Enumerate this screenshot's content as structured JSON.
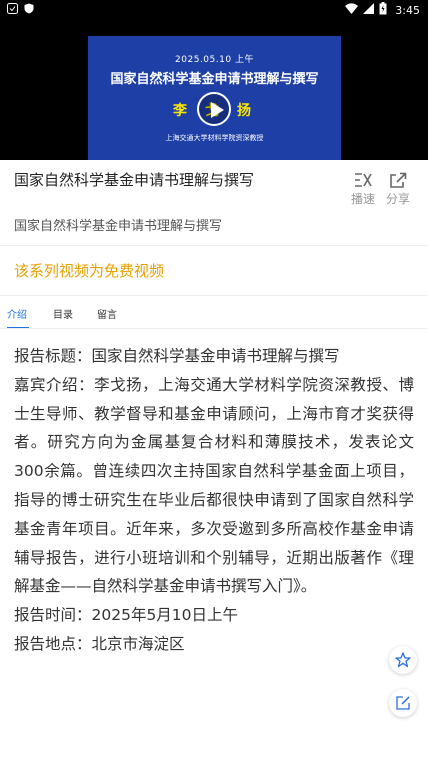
{
  "status_bar": {
    "time": "3:45",
    "battery": "battery-charging-icon",
    "wifi": "wifi-icon"
  },
  "video": {
    "slide_date": "2025.05.10 上午",
    "slide_title": "国家自然科学基金申请书理解与撰写",
    "slide_speaker": "李戈扬",
    "slide_affiliation": "上海交通大学材料学院资深教授"
  },
  "header": {
    "title": "国家自然科学基金申请书理解与撰写",
    "subtitle": "国家自然科学基金申请书理解与撰写",
    "actions": {
      "speed_label": "播速",
      "share_label": "分享"
    }
  },
  "free_notice": "该系列视频为免费视频",
  "tabs": [
    {
      "label": "介绍",
      "active": true
    },
    {
      "label": "目录",
      "active": false
    },
    {
      "label": "留言",
      "active": false
    }
  ],
  "content": {
    "report_title": "报告标题：国家自然科学基金申请书理解与撰写",
    "guest_intro": "嘉宾介绍：李戈扬，上海交通大学材料学院资深教授、博士生导师、教学督导和基金申请顾问，上海市育才奖获得者。研究方向为金属基复合材料和薄膜技术，发表论文300余篇。曾连续四次主持国家自然科学基金面上项目，指导的博士研究生在毕业后都很快申请到了国家自然科学基金青年项目。近年来，多次受邀到多所高校作基金申请辅导报告，进行小班培训和个别辅导，近期出版著作《理解基金——自然科学基金申请书撰写入门》。",
    "report_time": "报告时间：2025年5月10日上午",
    "report_place": "报告地点：北京市海淀区"
  },
  "colors": {
    "accent": "#1a73e8",
    "free": "#e8a200",
    "slide_bg": "#1d3fa6",
    "speaker": "#ffe600"
  }
}
